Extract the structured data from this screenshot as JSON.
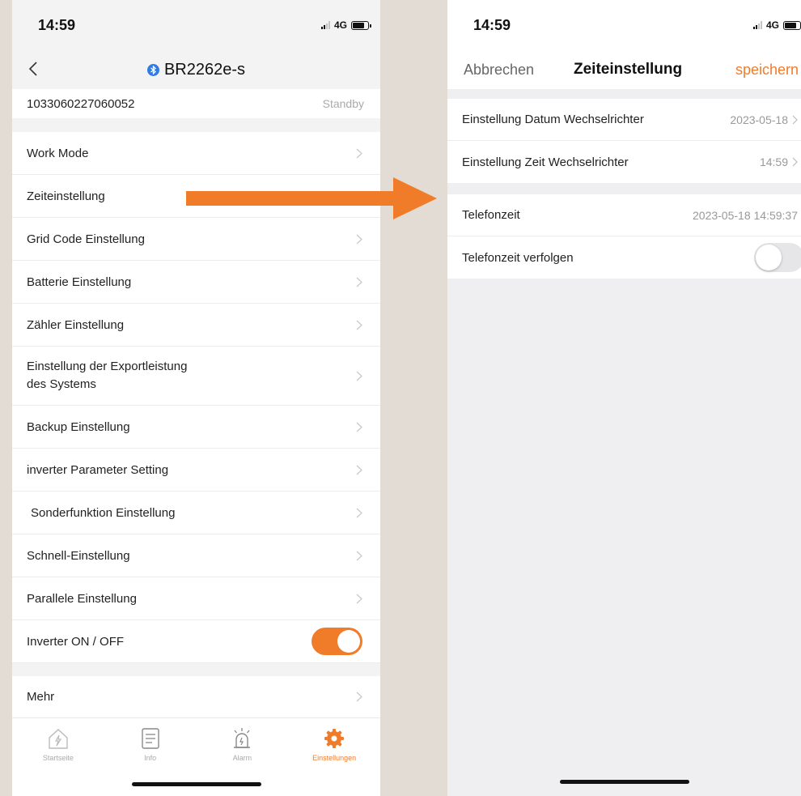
{
  "left_phone": {
    "status_bar": {
      "time": "14:59",
      "network": "4G"
    },
    "header": {
      "device_name": "BR2262e-s"
    },
    "device_info": {
      "serial": "1033060227060052",
      "status": "Standby"
    },
    "menu": {
      "items": [
        {
          "label": "Work Mode"
        },
        {
          "label": "Zeiteinstellung"
        },
        {
          "label": "Grid Code Einstellung"
        },
        {
          "label": "Batterie Einstellung"
        },
        {
          "label": "Zähler Einstellung"
        },
        {
          "label": "Einstellung der Exportleistung",
          "label2": "des Systems"
        },
        {
          "label": "Backup Einstellung"
        },
        {
          "label": "inverter Parameter Setting"
        },
        {
          "label": "Sonderfunktion Einstellung"
        },
        {
          "label": "Schnell-Einstellung"
        },
        {
          "label": "Parallele Einstellung"
        },
        {
          "label": "Inverter ON / OFF",
          "toggle": true
        }
      ],
      "more_label": "Mehr"
    },
    "tab_bar": {
      "tabs": [
        {
          "label": "Startseite",
          "icon": "home-bolt-icon"
        },
        {
          "label": "Info",
          "icon": "document-icon"
        },
        {
          "label": "Alarm",
          "icon": "alarm-siren-icon"
        },
        {
          "label": "Einstellungen",
          "icon": "gear-icon",
          "active": true
        }
      ]
    }
  },
  "right_phone": {
    "status_bar": {
      "time": "14:59",
      "network": "4G"
    },
    "nav": {
      "cancel_label": "Abbrechen",
      "title": "Zeiteinstellung",
      "save_label": "speichern"
    },
    "inverter_settings": {
      "date_label": "Einstellung Datum Wechselrichter",
      "date_value": "2023-05-18",
      "time_label": "Einstellung Zeit Wechselrichter",
      "time_value": "14:59"
    },
    "phone_time": {
      "label": "Telefonzeit",
      "value": "2023-05-18 14:59:37",
      "follow_label": "Telefonzeit verfolgen",
      "follow_enabled": false
    }
  },
  "colors": {
    "accent": "#f07c2a",
    "bluetooth": "#2f7be8",
    "arrow": "#f07c2a"
  }
}
